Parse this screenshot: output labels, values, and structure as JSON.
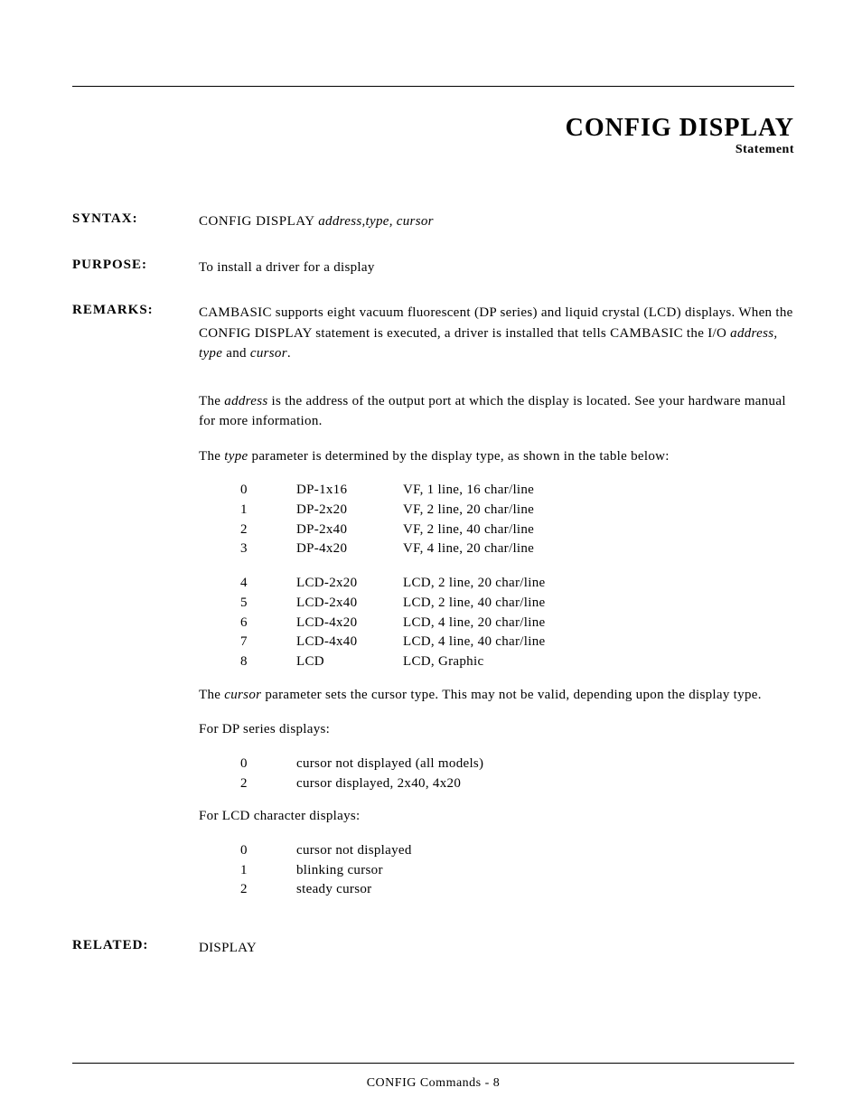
{
  "header": {
    "title": "CONFIG DISPLAY",
    "subtitle": "Statement"
  },
  "syntax": {
    "label": "SYNTAX:",
    "command": "CONFIG DISPLAY ",
    "args": "address,type, cursor"
  },
  "purpose": {
    "label": "PURPOSE:",
    "text": "To install a driver for a display"
  },
  "remarks": {
    "label": "REMARKS:",
    "para1_a": "CAMBASIC supports eight vacuum fluorescent (DP series) and liquid crystal (LCD) displays.  When the CONFIG DISPLAY statement is executed, a driver is installed that tells CAMBASIC the I/O ",
    "para1_b": "address, type",
    "para1_c": " and ",
    "para1_d": "cursor",
    "para1_e": ".",
    "para2_a": "The ",
    "para2_b": "address",
    "para2_c": " is the address of the output port at which the display is located.  See your hardware manual for more information.",
    "para3_a": "The ",
    "para3_b": "type",
    "para3_c": " parameter is determined by the display type, as shown in the table below:",
    "type_table": [
      {
        "n": "0",
        "model": "DP-1x16",
        "desc": "VF, 1 line, 16 char/line"
      },
      {
        "n": "1",
        "model": "DP-2x20",
        "desc": "VF, 2 line, 20 char/line"
      },
      {
        "n": "2",
        "model": "DP-2x40",
        "desc": "VF, 2 line, 40 char/line"
      },
      {
        "n": "3",
        "model": "DP-4x20",
        "desc": "VF, 4 line, 20 char/line"
      }
    ],
    "type_table2": [
      {
        "n": "4",
        "model": "LCD-2x20",
        "desc": "LCD, 2 line, 20 char/line"
      },
      {
        "n": "5",
        "model": "LCD-2x40",
        "desc": "LCD, 2 line, 40 char/line"
      },
      {
        "n": "6",
        "model": "LCD-4x20",
        "desc": "LCD, 4 line, 20 char/line"
      },
      {
        "n": "7",
        "model": "LCD-4x40",
        "desc": "LCD, 4 line, 40 char/line"
      },
      {
        "n": "8",
        "model": "LCD",
        "desc": "LCD, Graphic"
      }
    ],
    "para4_a": "The ",
    "para4_b": "cursor",
    "para4_c": " parameter sets the cursor type.  This may not be valid, depending upon the display type.",
    "para5": "For DP series displays:",
    "dp_cursor": [
      {
        "n": "0",
        "desc": "cursor not displayed (all models)"
      },
      {
        "n": "2",
        "desc": "cursor displayed, 2x40, 4x20"
      }
    ],
    "para6": "For LCD character displays:",
    "lcd_cursor": [
      {
        "n": "0",
        "desc": "cursor not displayed"
      },
      {
        "n": "1",
        "desc": "blinking cursor"
      },
      {
        "n": "2",
        "desc": "steady cursor"
      }
    ]
  },
  "related": {
    "label": "RELATED:",
    "text": "DISPLAY"
  },
  "footer": "CONFIG Commands - 8"
}
